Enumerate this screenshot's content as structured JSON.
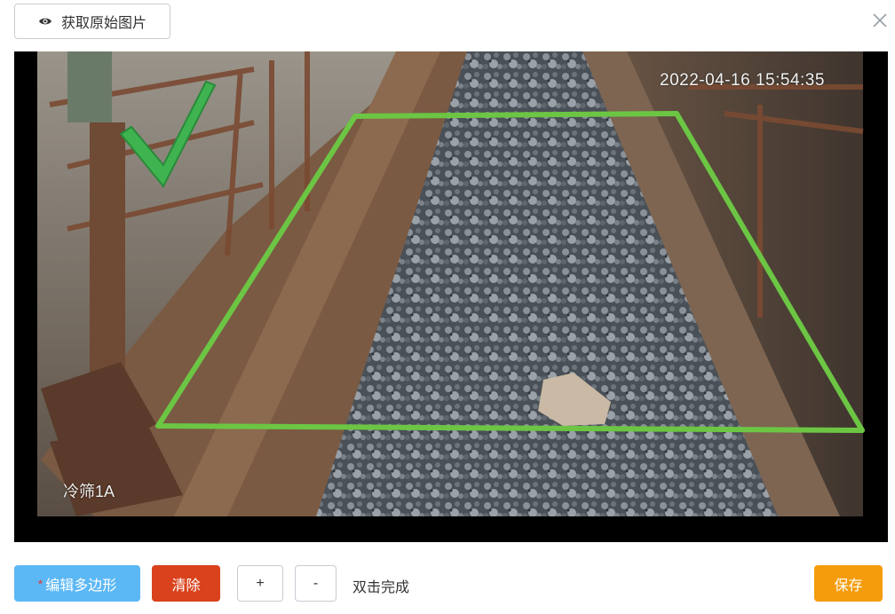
{
  "toolbar": {
    "original_image_label": "获取原始图片"
  },
  "image": {
    "timestamp": "2022-04-16 15:54:35",
    "channel_label": "冷筛1A"
  },
  "controls": {
    "edit_polygon_label": "编辑多边形",
    "required_marker": "*",
    "clear_label": "清除",
    "zoom_in_label": "+",
    "zoom_out_label": "-",
    "hint": "双击完成",
    "save_label": "保存"
  },
  "colors": {
    "polygon": "#6cc644",
    "edit_button": "#5cb8f5",
    "clear_button": "#d9421c",
    "save_button": "#f49c0b"
  },
  "icons": {
    "view": "eye-icon",
    "close": "close-icon",
    "status": "checkmark-icon"
  }
}
